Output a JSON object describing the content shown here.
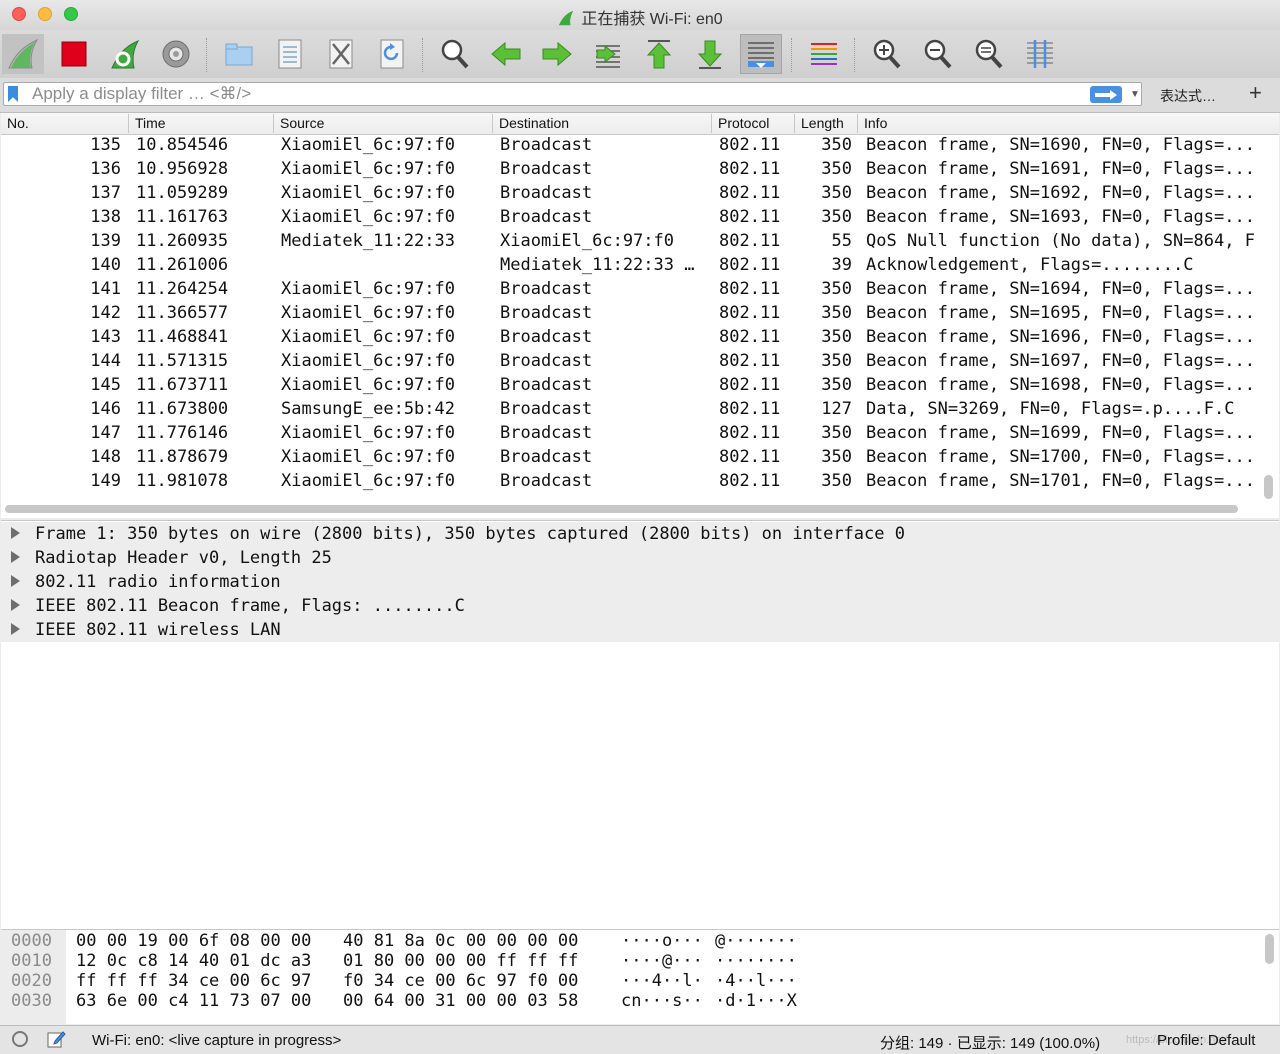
{
  "window": {
    "title": "正在捕获 Wi-Fi: en0"
  },
  "filter": {
    "placeholder": "Apply a display filter … <⌘/>",
    "expression_label": "表达式…",
    "add_label": "+"
  },
  "columns": {
    "no": "No.",
    "time": "Time",
    "source": "Source",
    "destination": "Destination",
    "protocol": "Protocol",
    "length": "Length",
    "info": "Info"
  },
  "packets": [
    {
      "no": "135",
      "time": "10.854546",
      "source": "XiaomiEl_6c:97:f0",
      "destination": "Broadcast",
      "protocol": "802.11",
      "length": "350",
      "info": "Beacon frame, SN=1690, FN=0, Flags=..."
    },
    {
      "no": "136",
      "time": "10.956928",
      "source": "XiaomiEl_6c:97:f0",
      "destination": "Broadcast",
      "protocol": "802.11",
      "length": "350",
      "info": "Beacon frame, SN=1691, FN=0, Flags=..."
    },
    {
      "no": "137",
      "time": "11.059289",
      "source": "XiaomiEl_6c:97:f0",
      "destination": "Broadcast",
      "protocol": "802.11",
      "length": "350",
      "info": "Beacon frame, SN=1692, FN=0, Flags=..."
    },
    {
      "no": "138",
      "time": "11.161763",
      "source": "XiaomiEl_6c:97:f0",
      "destination": "Broadcast",
      "protocol": "802.11",
      "length": "350",
      "info": "Beacon frame, SN=1693, FN=0, Flags=..."
    },
    {
      "no": "139",
      "time": "11.260935",
      "source": "Mediatek_11:22:33",
      "destination": "XiaomiEl_6c:97:f0",
      "protocol": "802.11",
      "length": "55",
      "info": "QoS Null function (No data), SN=864, F"
    },
    {
      "no": "140",
      "time": "11.261006",
      "source": "",
      "destination": "Mediatek_11:22:33 …",
      "protocol": "802.11",
      "length": "39",
      "info": "Acknowledgement, Flags=........C"
    },
    {
      "no": "141",
      "time": "11.264254",
      "source": "XiaomiEl_6c:97:f0",
      "destination": "Broadcast",
      "protocol": "802.11",
      "length": "350",
      "info": "Beacon frame, SN=1694, FN=0, Flags=..."
    },
    {
      "no": "142",
      "time": "11.366577",
      "source": "XiaomiEl_6c:97:f0",
      "destination": "Broadcast",
      "protocol": "802.11",
      "length": "350",
      "info": "Beacon frame, SN=1695, FN=0, Flags=..."
    },
    {
      "no": "143",
      "time": "11.468841",
      "source": "XiaomiEl_6c:97:f0",
      "destination": "Broadcast",
      "protocol": "802.11",
      "length": "350",
      "info": "Beacon frame, SN=1696, FN=0, Flags=..."
    },
    {
      "no": "144",
      "time": "11.571315",
      "source": "XiaomiEl_6c:97:f0",
      "destination": "Broadcast",
      "protocol": "802.11",
      "length": "350",
      "info": "Beacon frame, SN=1697, FN=0, Flags=..."
    },
    {
      "no": "145",
      "time": "11.673711",
      "source": "XiaomiEl_6c:97:f0",
      "destination": "Broadcast",
      "protocol": "802.11",
      "length": "350",
      "info": "Beacon frame, SN=1698, FN=0, Flags=..."
    },
    {
      "no": "146",
      "time": "11.673800",
      "source": "SamsungE_ee:5b:42",
      "destination": "Broadcast",
      "protocol": "802.11",
      "length": "127",
      "info": "Data, SN=3269, FN=0, Flags=.p....F.C"
    },
    {
      "no": "147",
      "time": "11.776146",
      "source": "XiaomiEl_6c:97:f0",
      "destination": "Broadcast",
      "protocol": "802.11",
      "length": "350",
      "info": "Beacon frame, SN=1699, FN=0, Flags=..."
    },
    {
      "no": "148",
      "time": "11.878679",
      "source": "XiaomiEl_6c:97:f0",
      "destination": "Broadcast",
      "protocol": "802.11",
      "length": "350",
      "info": "Beacon frame, SN=1700, FN=0, Flags=..."
    },
    {
      "no": "149",
      "time": "11.981078",
      "source": "XiaomiEl_6c:97:f0",
      "destination": "Broadcast",
      "protocol": "802.11",
      "length": "350",
      "info": "Beacon frame, SN=1701, FN=0, Flags=..."
    }
  ],
  "details": [
    "Frame 1: 350 bytes on wire (2800 bits), 350 bytes captured (2800 bits) on interface 0",
    "Radiotap Header v0, Length 25",
    "802.11 radio information",
    "IEEE 802.11 Beacon frame, Flags: ........C",
    "IEEE 802.11 wireless LAN"
  ],
  "hex": [
    {
      "offset": "0000",
      "bytes1": "00 00 19 00 6f 08 00 00",
      "bytes2": "40 81 8a 0c 00 00 00 00",
      "ascii1": "····o···",
      "ascii2": "@·······"
    },
    {
      "offset": "0010",
      "bytes1": "12 0c c8 14 40 01 dc a3",
      "bytes2": "01 80 00 00 00 ff ff ff",
      "ascii1": "····@···",
      "ascii2": "········"
    },
    {
      "offset": "0020",
      "bytes1": "ff ff ff 34 ce 00 6c 97",
      "bytes2": "f0 34 ce 00 6c 97 f0 00",
      "ascii1": "···4··l·",
      "ascii2": "·4··l···"
    },
    {
      "offset": "0030",
      "bytes1": "63 6e 00 c4 11 73 07 00",
      "bytes2": "00 64 00 31 00 00 03 58",
      "ascii1": "cn···s··",
      "ascii2": "·d·1···X"
    }
  ],
  "status": {
    "capture": "Wi-Fi: en0: <live capture in progress>",
    "counts": "分组: 149 · 已显示: 149 (100.0%)",
    "profile": "Profile: Default",
    "watermark": "https://blog.csdn.net/..."
  },
  "toolbar_icons": [
    "shark-fin-start-icon",
    "stop-capture-icon",
    "restart-capture-icon",
    "capture-options-icon",
    "open-file-icon",
    "save-file-icon",
    "close-file-icon",
    "reload-file-icon",
    "find-packet-icon",
    "go-back-icon",
    "go-forward-icon",
    "go-to-packet-icon",
    "go-first-icon",
    "go-last-icon",
    "autoscroll-icon",
    "colorize-icon",
    "zoom-in-icon",
    "zoom-out-icon",
    "zoom-normal-icon",
    "resize-columns-icon"
  ],
  "colors": {
    "accent": "#4a90e2",
    "stop": "#e0001b",
    "shark": "#3fa83f",
    "selection": "#ededed"
  }
}
